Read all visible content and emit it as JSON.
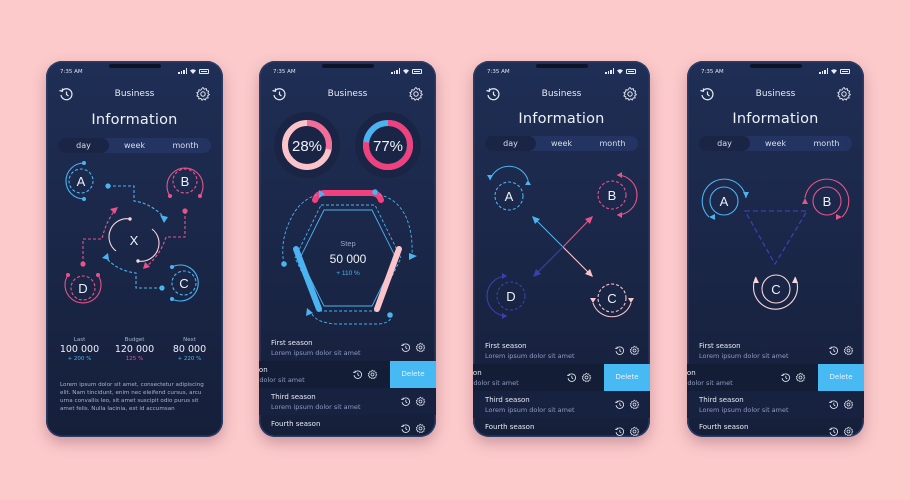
{
  "status": {
    "time": "7:35 AM"
  },
  "header": {
    "title": "Business",
    "left_icon": "history-icon",
    "right_icon": "gear-icon"
  },
  "info": {
    "title": "Information"
  },
  "tabs": [
    {
      "label": "day",
      "active": true
    },
    {
      "label": "week",
      "active": false
    },
    {
      "label": "month",
      "active": false
    }
  ],
  "screen1": {
    "nodes": [
      "A",
      "B",
      "C",
      "D",
      "X"
    ],
    "stats": [
      {
        "label": "Last",
        "value": "100 000",
        "change": "+ 200 %",
        "color": "#4ab3f0"
      },
      {
        "label": "Budget",
        "value": "120 000",
        "change": "125 %",
        "color": "#e8548a"
      },
      {
        "label": "Next",
        "value": "80 000",
        "change": "+ 220 %",
        "color": "#4ab3f0"
      }
    ],
    "lorem": "Lorem ipsum dolor sit amet, consectetur adipiscing elit. Nam tincidunt, enim nec eleifend cursus, arcu urna convallis leo, sit amet suscipit odio purus sit amet felis. Nulla lacinia, est id accumsan"
  },
  "screen2": {
    "donuts": [
      {
        "label": "28%",
        "percent": 28,
        "main_color": "#f26d9a",
        "rest_color": "#fbc4cb"
      },
      {
        "label": "77%",
        "percent": 77,
        "main_color": "#f0417e",
        "rest_color": "#4ab3f0"
      }
    ],
    "step": {
      "label": "Step",
      "value": "50 000",
      "change": "+ 110 %"
    }
  },
  "screen3": {
    "nodes": [
      "A",
      "B",
      "C",
      "D"
    ]
  },
  "screen4": {
    "nodes": [
      "A",
      "B",
      "C"
    ]
  },
  "list": {
    "rows": [
      {
        "title": "First season",
        "subtitle": "Lorem ipsum dolor sit amet"
      },
      {
        "title": "ason",
        "subtitle": "m dolor sit amet",
        "swiped": true,
        "action": "Delete"
      },
      {
        "title": "Third season",
        "subtitle": "Lorem ipsum dolor sit amet"
      },
      {
        "title": "Fourth season",
        "subtitle": ""
      }
    ]
  },
  "colors": {
    "background": "#fccacb",
    "phone": "#1f2e55",
    "blue": "#4ab3f0",
    "pink": "#f0417e",
    "lightpink": "#fbc4cb",
    "indigo": "#3b3fb0",
    "delete": "#47b9f3"
  }
}
